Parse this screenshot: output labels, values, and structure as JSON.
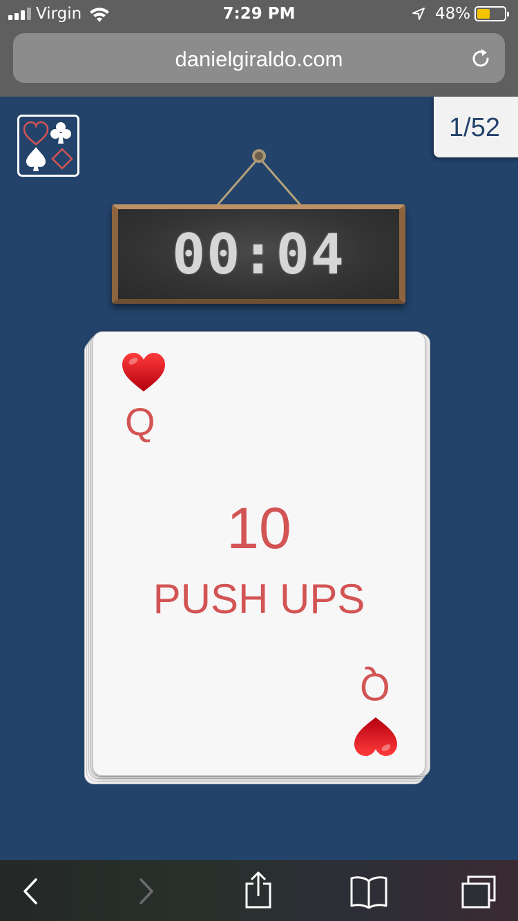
{
  "status_bar": {
    "carrier": "Virgin",
    "time": "7:29 PM",
    "battery_percent": "48%",
    "battery_level": 0.48
  },
  "browser": {
    "url": "danielgiraldo.com"
  },
  "app": {
    "counter": "1/52",
    "timer": "00:04",
    "card": {
      "rank": "Q",
      "suit": "hearts",
      "reps": "10",
      "exercise": "PUSH UPS"
    },
    "colors": {
      "background": "#23436a",
      "card_red": "#d35454",
      "heart": "#d0021b"
    }
  },
  "toolbar": {
    "icons": [
      "back-icon",
      "forward-icon",
      "share-icon",
      "bookmarks-icon",
      "tabs-icon"
    ]
  }
}
